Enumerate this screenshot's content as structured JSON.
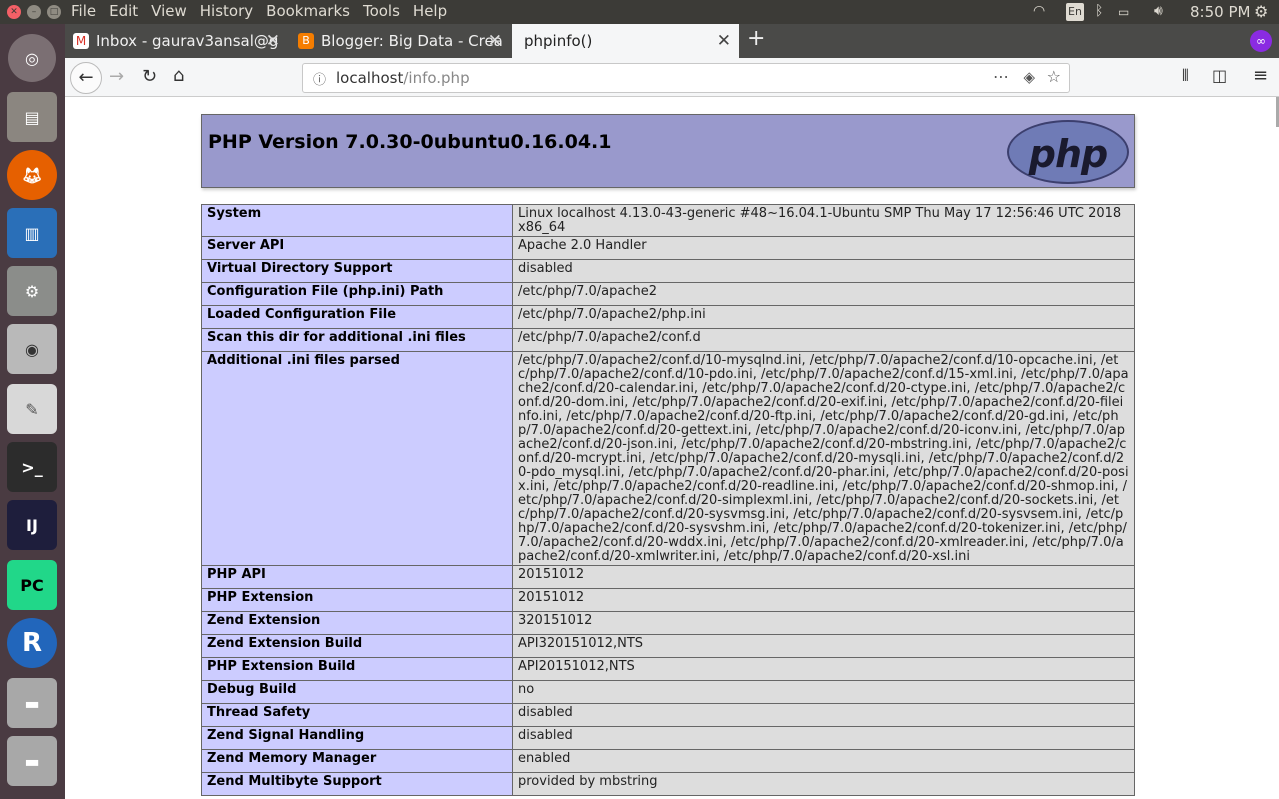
{
  "menubar": {
    "items": [
      "File",
      "Edit",
      "View",
      "History",
      "Bookmarks",
      "Tools",
      "Help"
    ],
    "input_lang": "En",
    "clock": "8:50 PM"
  },
  "launcher": {
    "apps": [
      "Ubuntu Dash",
      "Files",
      "Firefox",
      "LibreOffice Writer",
      "System Settings",
      "Shotwell",
      "Text Editor",
      "Terminal",
      "IntelliJ IDEA",
      "PyCharm",
      "R",
      "Disk",
      "Disk"
    ]
  },
  "tabs": [
    {
      "label": "Inbox - gaurav3ansal@g",
      "favicon": "gmail-icon"
    },
    {
      "label": "Blogger: Big Data - Crea",
      "favicon": "blogger-icon"
    },
    {
      "label": "phpinfo()",
      "favicon": ""
    }
  ],
  "address": {
    "host": "localhost",
    "path": "/info.php"
  },
  "php": {
    "title": "PHP Version 7.0.30-0ubuntu0.16.04.1",
    "logo": "php",
    "rows": [
      {
        "k": "System",
        "v": "Linux localhost 4.13.0-43-generic #48~16.04.1-Ubuntu SMP Thu May 17 12:56:46 UTC 2018 x86_64"
      },
      {
        "k": "Server API",
        "v": "Apache 2.0 Handler"
      },
      {
        "k": "Virtual Directory Support",
        "v": "disabled"
      },
      {
        "k": "Configuration File (php.ini) Path",
        "v": "/etc/php/7.0/apache2"
      },
      {
        "k": "Loaded Configuration File",
        "v": "/etc/php/7.0/apache2/php.ini"
      },
      {
        "k": "Scan this dir for additional .ini files",
        "v": "/etc/php/7.0/apache2/conf.d"
      },
      {
        "k": "Additional .ini files parsed",
        "v": "/etc/php/7.0/apache2/conf.d/10-mysqlnd.ini, /etc/php/7.0/apache2/conf.d/10-opcache.ini, /etc/php/7.0/apache2/conf.d/10-pdo.ini, /etc/php/7.0/apache2/conf.d/15-xml.ini, /etc/php/7.0/apache2/conf.d/20-calendar.ini, /etc/php/7.0/apache2/conf.d/20-ctype.ini, /etc/php/7.0/apache2/conf.d/20-dom.ini, /etc/php/7.0/apache2/conf.d/20-exif.ini, /etc/php/7.0/apache2/conf.d/20-fileinfo.ini, /etc/php/7.0/apache2/conf.d/20-ftp.ini, /etc/php/7.0/apache2/conf.d/20-gd.ini, /etc/php/7.0/apache2/conf.d/20-gettext.ini, /etc/php/7.0/apache2/conf.d/20-iconv.ini, /etc/php/7.0/apache2/conf.d/20-json.ini, /etc/php/7.0/apache2/conf.d/20-mbstring.ini, /etc/php/7.0/apache2/conf.d/20-mcrypt.ini, /etc/php/7.0/apache2/conf.d/20-mysqli.ini, /etc/php/7.0/apache2/conf.d/20-pdo_mysql.ini, /etc/php/7.0/apache2/conf.d/20-phar.ini, /etc/php/7.0/apache2/conf.d/20-posix.ini, /etc/php/7.0/apache2/conf.d/20-readline.ini, /etc/php/7.0/apache2/conf.d/20-shmop.ini, /etc/php/7.0/apache2/conf.d/20-simplexml.ini, /etc/php/7.0/apache2/conf.d/20-sockets.ini, /etc/php/7.0/apache2/conf.d/20-sysvmsg.ini, /etc/php/7.0/apache2/conf.d/20-sysvsem.ini, /etc/php/7.0/apache2/conf.d/20-sysvshm.ini, /etc/php/7.0/apache2/conf.d/20-tokenizer.ini, /etc/php/7.0/apache2/conf.d/20-wddx.ini, /etc/php/7.0/apache2/conf.d/20-xmlreader.ini, /etc/php/7.0/apache2/conf.d/20-xmlwriter.ini, /etc/php/7.0/apache2/conf.d/20-xsl.ini"
      },
      {
        "k": "PHP API",
        "v": "20151012"
      },
      {
        "k": "PHP Extension",
        "v": "20151012"
      },
      {
        "k": "Zend Extension",
        "v": "320151012"
      },
      {
        "k": "Zend Extension Build",
        "v": "API320151012,NTS"
      },
      {
        "k": "PHP Extension Build",
        "v": "API20151012,NTS"
      },
      {
        "k": "Debug Build",
        "v": "no"
      },
      {
        "k": "Thread Safety",
        "v": "disabled"
      },
      {
        "k": "Zend Signal Handling",
        "v": "disabled"
      },
      {
        "k": "Zend Memory Manager",
        "v": "enabled"
      },
      {
        "k": "Zend Multibyte Support",
        "v": "provided by mbstring"
      }
    ]
  }
}
